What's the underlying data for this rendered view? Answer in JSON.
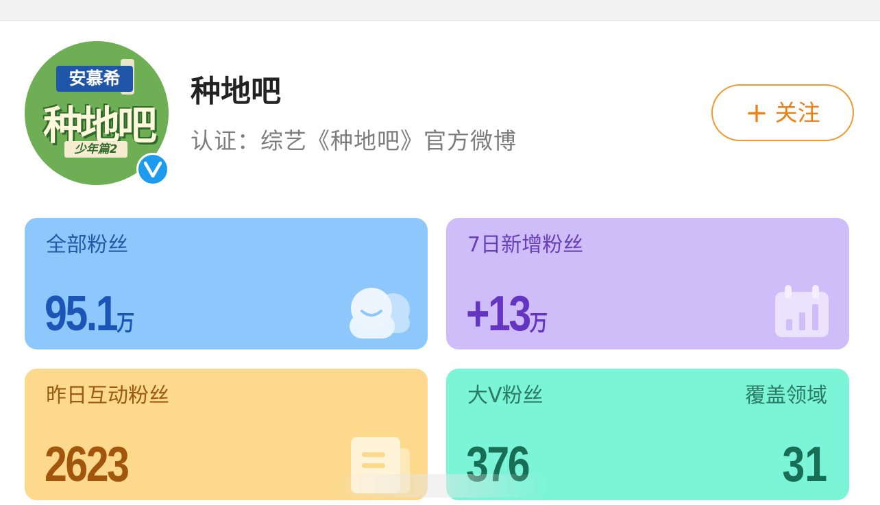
{
  "profile": {
    "name": "种地吧",
    "verification": "认证：综艺《种地吧》官方微博",
    "avatar": {
      "brand_text": "安慕希",
      "logo_text": "种地吧",
      "sub_text": "少年篇2"
    },
    "verified_icon": "verified-v-icon"
  },
  "follow_button": {
    "icon": "plus-icon",
    "label": "关注"
  },
  "stats": {
    "total_fans": {
      "label": "全部粉丝",
      "value": "95.1",
      "unit": "万",
      "icon": "fans-face-icon"
    },
    "new_fans_7d": {
      "label": "7日新增粉丝",
      "value": "+13",
      "unit": "万",
      "icon": "calendar-chart-icon"
    },
    "interactive_fans": {
      "label": "昨日互动粉丝",
      "value": "2623",
      "icon": "document-icon"
    },
    "big_v_fans": {
      "label": "大V粉丝",
      "value": "376",
      "right_label": "覆盖领域",
      "right_value": "31"
    }
  },
  "colors": {
    "follow_accent": "#f07f12",
    "verified_badge": "#1d9bf0",
    "card_blue": "#8ec7fb",
    "card_purple": "#cfbdfa",
    "card_yellow": "#fcd98c",
    "card_green": "#7bf4d8"
  }
}
